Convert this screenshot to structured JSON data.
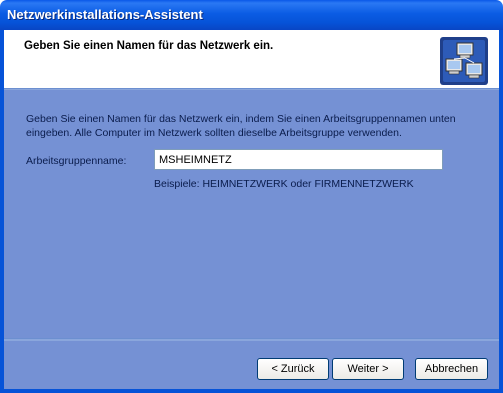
{
  "window": {
    "title": "Netzwerkinstallations-Assistent"
  },
  "header": {
    "title": "Geben Sie einen Namen für das Netzwerk ein.",
    "icon": "network-computers-icon"
  },
  "body": {
    "description_line1": "Geben Sie einen Namen für das Netzwerk ein, indem Sie einen Arbeitsgruppennamen unten",
    "description_line2": "eingeben. Alle Computer im Netzwerk sollten dieselbe Arbeitsgruppe verwenden.",
    "workgroup_label": "Arbeitsgruppenname:",
    "workgroup_value": "MSHEIMNETZ",
    "hint": "Beispiele: HEIMNETZWERK oder FIRMENNETZWERK"
  },
  "buttons": {
    "back": "< Zurück",
    "next": "Weiter >",
    "cancel": "Abbrechen"
  },
  "colors": {
    "titlebar": "#0653d8",
    "body_bg": "#7591d4",
    "header_bg": "#ffffff"
  }
}
